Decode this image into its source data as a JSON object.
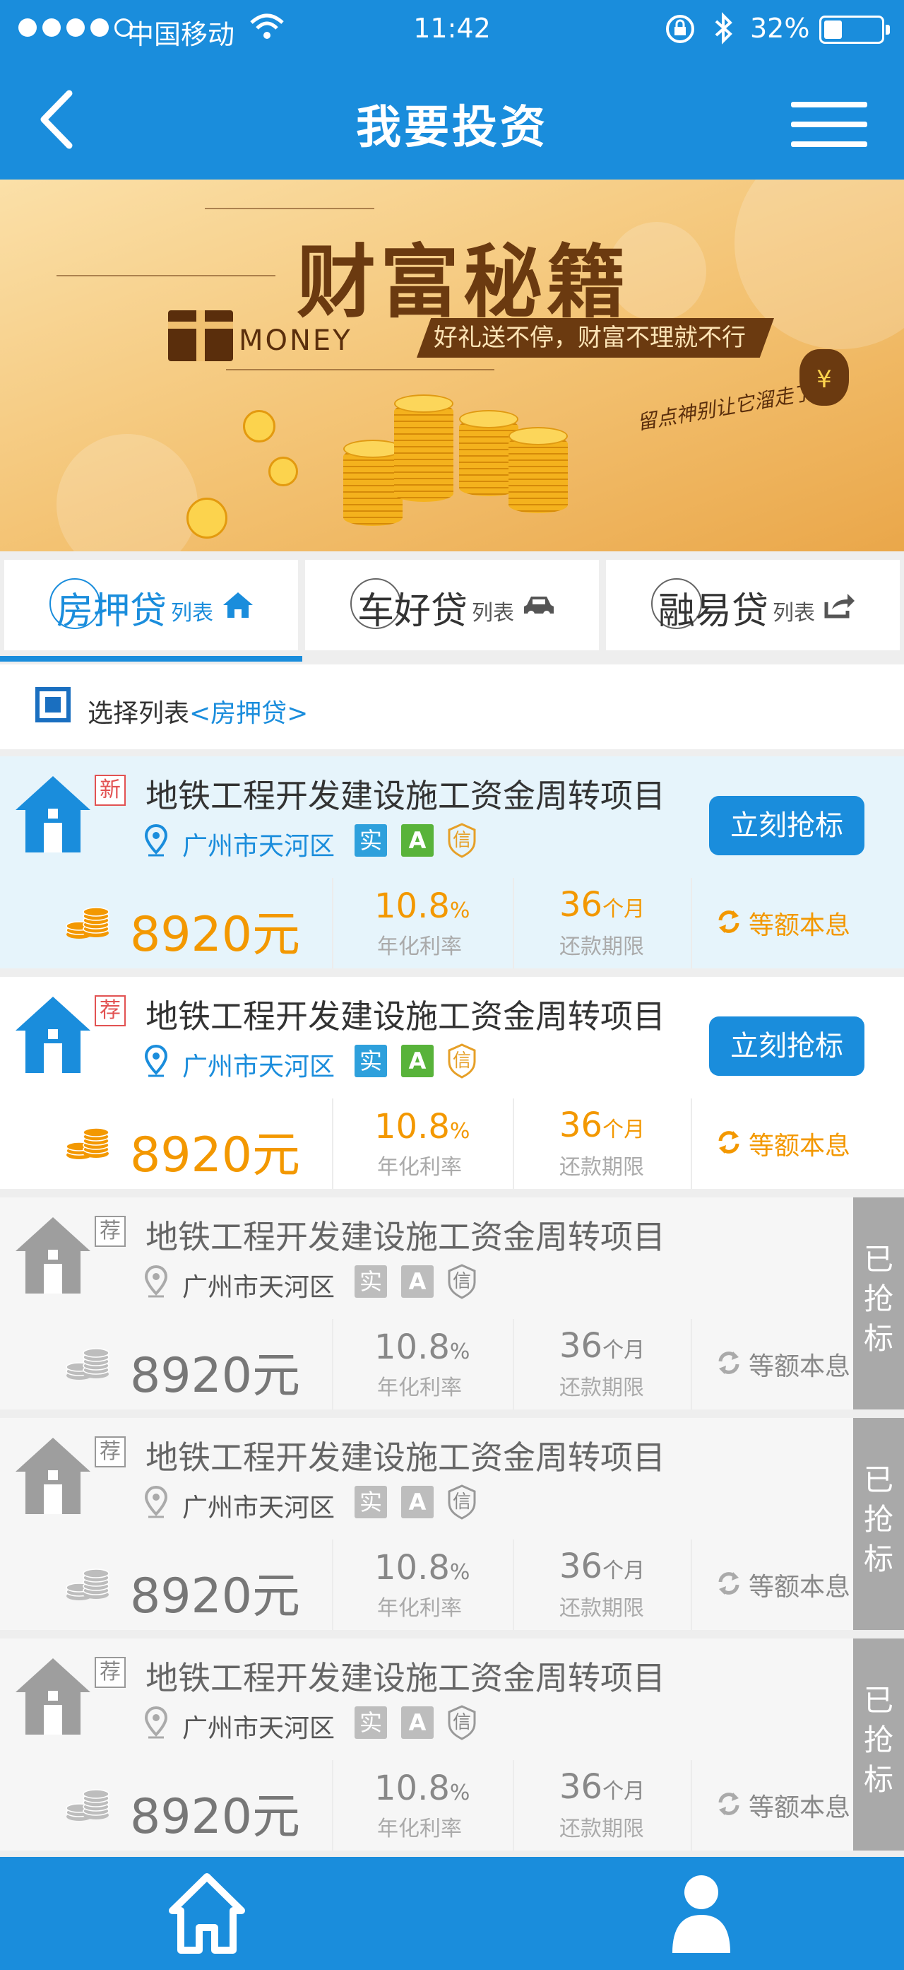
{
  "status_bar": {
    "carrier": "中国移动",
    "time": "11:42",
    "battery_percent": "32%",
    "battery_level": 0.32,
    "signal_bars": 4,
    "icons": [
      "wifi-icon",
      "rotation-lock-icon",
      "bluetooth-icon",
      "battery-icon"
    ]
  },
  "header": {
    "title": "我要投资",
    "icons": [
      "back-arrow-icon",
      "menu-icon"
    ]
  },
  "banner": {
    "headline": "财富秘籍",
    "money_text": "MONEY",
    "slogan": "好礼送不停，财富不理就不行",
    "note": "留点神别让它溜走了!"
  },
  "tabs": [
    {
      "big": "房押贷",
      "small": "列表",
      "icon": "house-icon",
      "active": true
    },
    {
      "big": "车好贷",
      "small": "列表",
      "icon": "car-icon",
      "active": false
    },
    {
      "big": "融易贷",
      "small": "列表",
      "icon": "share-icon",
      "active": false
    }
  ],
  "select_row": {
    "label": "选择列表",
    "selected": "<房押贷>"
  },
  "projects": [
    {
      "tag": "新",
      "title": "地铁工程开发建设施工资金周转项目",
      "location": "广州市天河区",
      "badge_shi": "实",
      "badge_a": "A",
      "badge_xin": "信",
      "amount": "8920元",
      "rate_value": "10.8",
      "rate_unit": "%",
      "rate_label": "年化利率",
      "term_value": "36",
      "term_unit": "个月",
      "term_label": "还款期限",
      "repay": "等额本息",
      "action": "立刻抢标",
      "status": "open"
    },
    {
      "tag": "荐",
      "title": "地铁工程开发建设施工资金周转项目",
      "location": "广州市天河区",
      "badge_shi": "实",
      "badge_a": "A",
      "badge_xin": "信",
      "amount": "8920元",
      "rate_value": "10.8",
      "rate_unit": "%",
      "rate_label": "年化利率",
      "term_value": "36",
      "term_unit": "个月",
      "term_label": "还款期限",
      "repay": "等额本息",
      "action": "立刻抢标",
      "status": "open"
    },
    {
      "tag": "荐",
      "title": "地铁工程开发建设施工资金周转项目",
      "location": "广州市天河区",
      "badge_shi": "实",
      "badge_a": "A",
      "badge_xin": "信",
      "amount": "8920元",
      "rate_value": "10.8",
      "rate_unit": "%",
      "rate_label": "年化利率",
      "term_value": "36",
      "term_unit": "个月",
      "term_label": "还款期限",
      "repay": "等额本息",
      "action": "已抢标",
      "status": "done"
    },
    {
      "tag": "荐",
      "title": "地铁工程开发建设施工资金周转项目",
      "location": "广州市天河区",
      "badge_shi": "实",
      "badge_a": "A",
      "badge_xin": "信",
      "amount": "8920元",
      "rate_value": "10.8",
      "rate_unit": "%",
      "rate_label": "年化利率",
      "term_value": "36",
      "term_unit": "个月",
      "term_label": "还款期限",
      "repay": "等额本息",
      "action": "已抢标",
      "status": "done"
    },
    {
      "tag": "荐",
      "title": "地铁工程开发建设施工资金周转项目",
      "location": "广州市天河区",
      "badge_shi": "实",
      "badge_a": "A",
      "badge_xin": "信",
      "amount": "8920元",
      "rate_value": "10.8",
      "rate_unit": "%",
      "rate_label": "年化利率",
      "term_value": "36",
      "term_unit": "个月",
      "term_label": "还款期限",
      "repay": "等额本息",
      "action": "已抢标",
      "status": "done"
    }
  ],
  "bottom_nav": {
    "items": [
      "home-icon",
      "user-icon"
    ]
  },
  "colors": {
    "primary": "#1a8ddc",
    "accent_orange": "#f39800",
    "highlight_bg": "#e6f4fb",
    "grabbed_gray": "#a9a9a9"
  }
}
